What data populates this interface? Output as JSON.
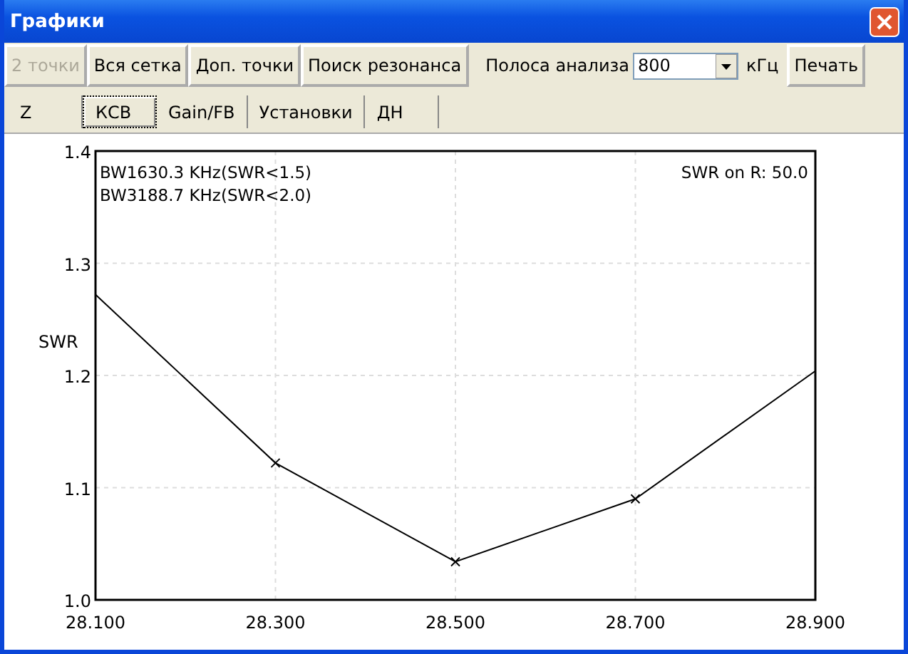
{
  "window": {
    "title": "Графики"
  },
  "toolbar": {
    "buttons": [
      {
        "label": "2 точки",
        "disabled": true
      },
      {
        "label": "Вся сетка",
        "disabled": false
      },
      {
        "label": "Доп. точки",
        "disabled": false
      },
      {
        "label": "Поиск резонанса",
        "disabled": false
      }
    ],
    "band_label": "Полоса анализа",
    "band_value": "800",
    "band_unit": "кГц",
    "print_button": "Печать"
  },
  "tabs": [
    {
      "label": "Z",
      "selected": false
    },
    {
      "label": "КСВ",
      "selected": true
    },
    {
      "label": "Gain/FB",
      "selected": false
    },
    {
      "label": "Установки",
      "selected": false
    },
    {
      "label": "ДН",
      "selected": false
    }
  ],
  "chart": {
    "notes": [
      "BW1630.3 KHz(SWR<1.5)",
      "BW3188.7 KHz(SWR<2.0)"
    ],
    "info": "SWR on R: 50.0",
    "chart_data": {
      "type": "line",
      "ylabel": "SWR",
      "x": [
        28.1,
        28.3,
        28.5,
        28.7,
        28.9
      ],
      "grid": true,
      "series": [
        {
          "color": "#000000",
          "values": [
            1.272,
            1.122,
            1.034,
            1.09,
            1.204
          ]
        }
      ],
      "xlim": [
        28.1,
        28.9
      ],
      "ylim": [
        1.0,
        1.4
      ],
      "xticks": [
        {
          "value": 28.1,
          "label": "28.100"
        },
        {
          "value": 28.3,
          "label": "28.300"
        },
        {
          "value": 28.5,
          "label": "28.500"
        },
        {
          "value": 28.7,
          "label": "28.700"
        },
        {
          "value": 28.9,
          "label": "28.900"
        }
      ],
      "yticks": [
        {
          "value": 1.0,
          "label": "1.0"
        },
        {
          "value": 1.1,
          "label": "1.1"
        },
        {
          "value": 1.2,
          "label": "1.2"
        },
        {
          "value": 1.3,
          "label": "1.3"
        },
        {
          "value": 1.4,
          "label": "1.4"
        }
      ]
    }
  }
}
